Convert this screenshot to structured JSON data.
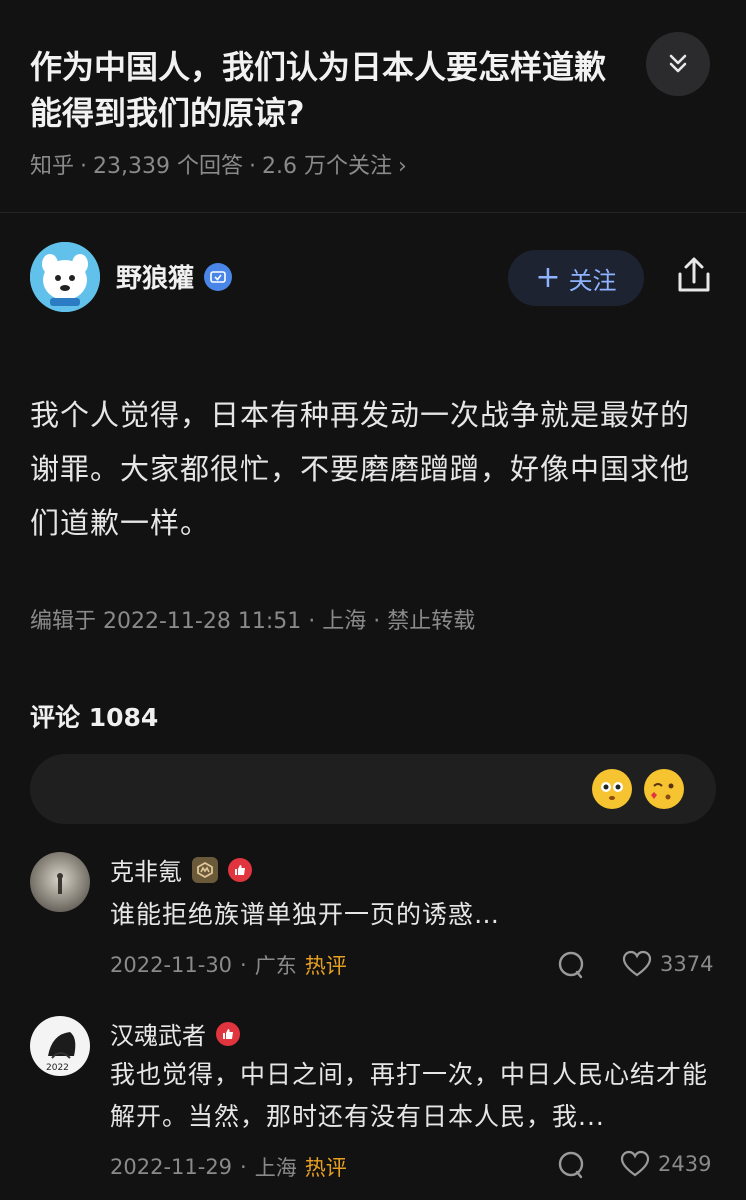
{
  "question": {
    "title": "作为中国人，我们认为日本人要怎样道歉\n能得到我们的原谅?",
    "source": "知乎",
    "answers_count": "23,339 个回答",
    "followers": "2.6 万个关注"
  },
  "author": {
    "name": "野狼獾",
    "follow_label": "关注"
  },
  "answer": {
    "text": "我个人觉得，日本有种再发动一次战争就是最好的谢罪。大家都很忙，不要磨磨蹭蹭，好像中国求他们道歉一样。",
    "edit_meta": "编辑于 2022-11-28 11:51 · 上海 · 禁止转载"
  },
  "comments_section": {
    "title": "评论 1084"
  },
  "comments": [
    {
      "name": "克非氪",
      "text": "谁能拒绝族谱单独开一页的诱惑…",
      "date": "2022-11-30",
      "location": "广东",
      "hot": "热评",
      "likes": "3374"
    },
    {
      "name": "汉魂武者",
      "text": "我也觉得，中日之间，再打一次，中日人民心结才能解开。当然，那时还有没有日本人民，我...",
      "date": "2022-11-29",
      "location": "上海",
      "hot": "热评",
      "likes": "2439"
    }
  ],
  "icons": {
    "collapse": "chevron-double-down-icon",
    "share": "share-icon",
    "reply": "comment-bubble-icon",
    "like": "heart-icon"
  },
  "colors": {
    "background": "#121212",
    "accent": "#8fb3ff",
    "hot": "#e8a020"
  }
}
